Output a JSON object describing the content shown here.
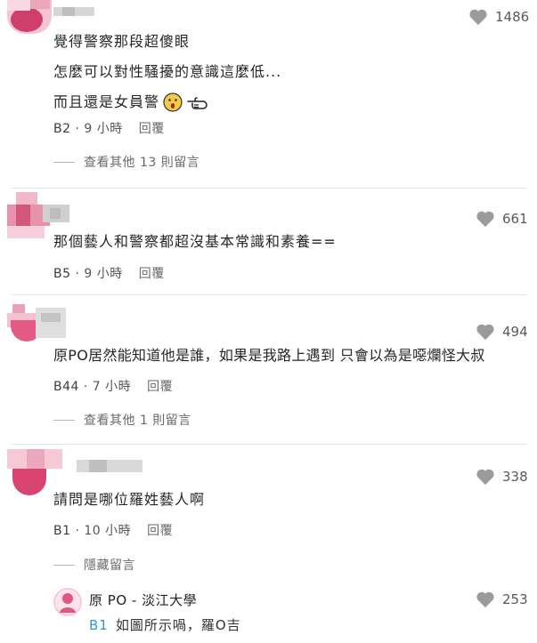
{
  "colors": {
    "floor_tag": "#3397cf",
    "heart": "#9b9b9b",
    "avatar_pink": "#e0577f"
  },
  "comments": [
    {
      "lines": [
        "覺得警察那段超傻眼",
        "怎麼可以對性騷擾的意識這麼低...",
        "而且還是女員警"
      ],
      "emojis": [
        "surprised-face",
        "pointing-hand"
      ],
      "likes": "1486",
      "floor": "B2",
      "time": "9 小時",
      "reply": "回覆",
      "more": "查看其他 13 則留言"
    },
    {
      "lines": [
        "那個藝人和警察都超沒基本常識和素養=="
      ],
      "likes": "661",
      "floor": "B5",
      "time": "9 小時",
      "reply": "回覆"
    },
    {
      "lines": [
        "原PO居然能知道他是誰，如果是我路上遇到 只會以為是噁爛怪大叔"
      ],
      "likes": "494",
      "floor": "B44",
      "time": "7 小時",
      "reply": "回覆",
      "more": "查看其他 1 則留言"
    },
    {
      "lines": [
        "請問是哪位羅姓藝人啊"
      ],
      "likes": "338",
      "floor": "B1",
      "time": "10 小時",
      "reply": "回覆",
      "more": "隱藏留言"
    }
  ],
  "op_reply": {
    "name": "原 PO - 淡江大學",
    "tag": "B1",
    "text": "如圖所示喎，羅O吉",
    "likes": "253"
  }
}
